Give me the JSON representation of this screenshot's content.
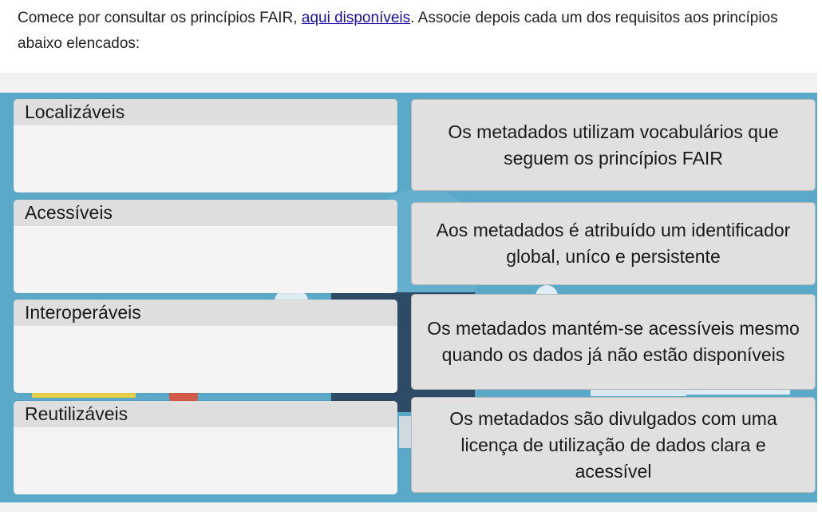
{
  "instructions": {
    "before": "Comece por consultar os princípios FAIR, ",
    "link": "aqui disponíveis",
    "after": ". Associe depois cada um dos requisitos aos princípios abaixo elencados:"
  },
  "drop_zones": [
    {
      "label": "Localizáveis"
    },
    {
      "label": "Acessíveis"
    },
    {
      "label": "Interoperáveis"
    },
    {
      "label": "Reutilizáveis"
    }
  ],
  "draggables": [
    {
      "text": "Os metadados utilizam vocabulários que seguem os princípios FAIR"
    },
    {
      "text": "Aos metadados é atribuído um identificador global, uníco e persistente"
    },
    {
      "text": "Os metadados mantém-se acessíveis mesmo quando os dados já não estão disponíveis"
    },
    {
      "text": "Os metadados são divulgados com uma licença de utilização de dados clara e acessível"
    }
  ],
  "colors": {
    "board": "#5aa9c9",
    "drop_zone": "#f4f4f4",
    "drop_label": "#dedede",
    "draggable": "#e0e0e0",
    "link": "#1a0dab"
  }
}
